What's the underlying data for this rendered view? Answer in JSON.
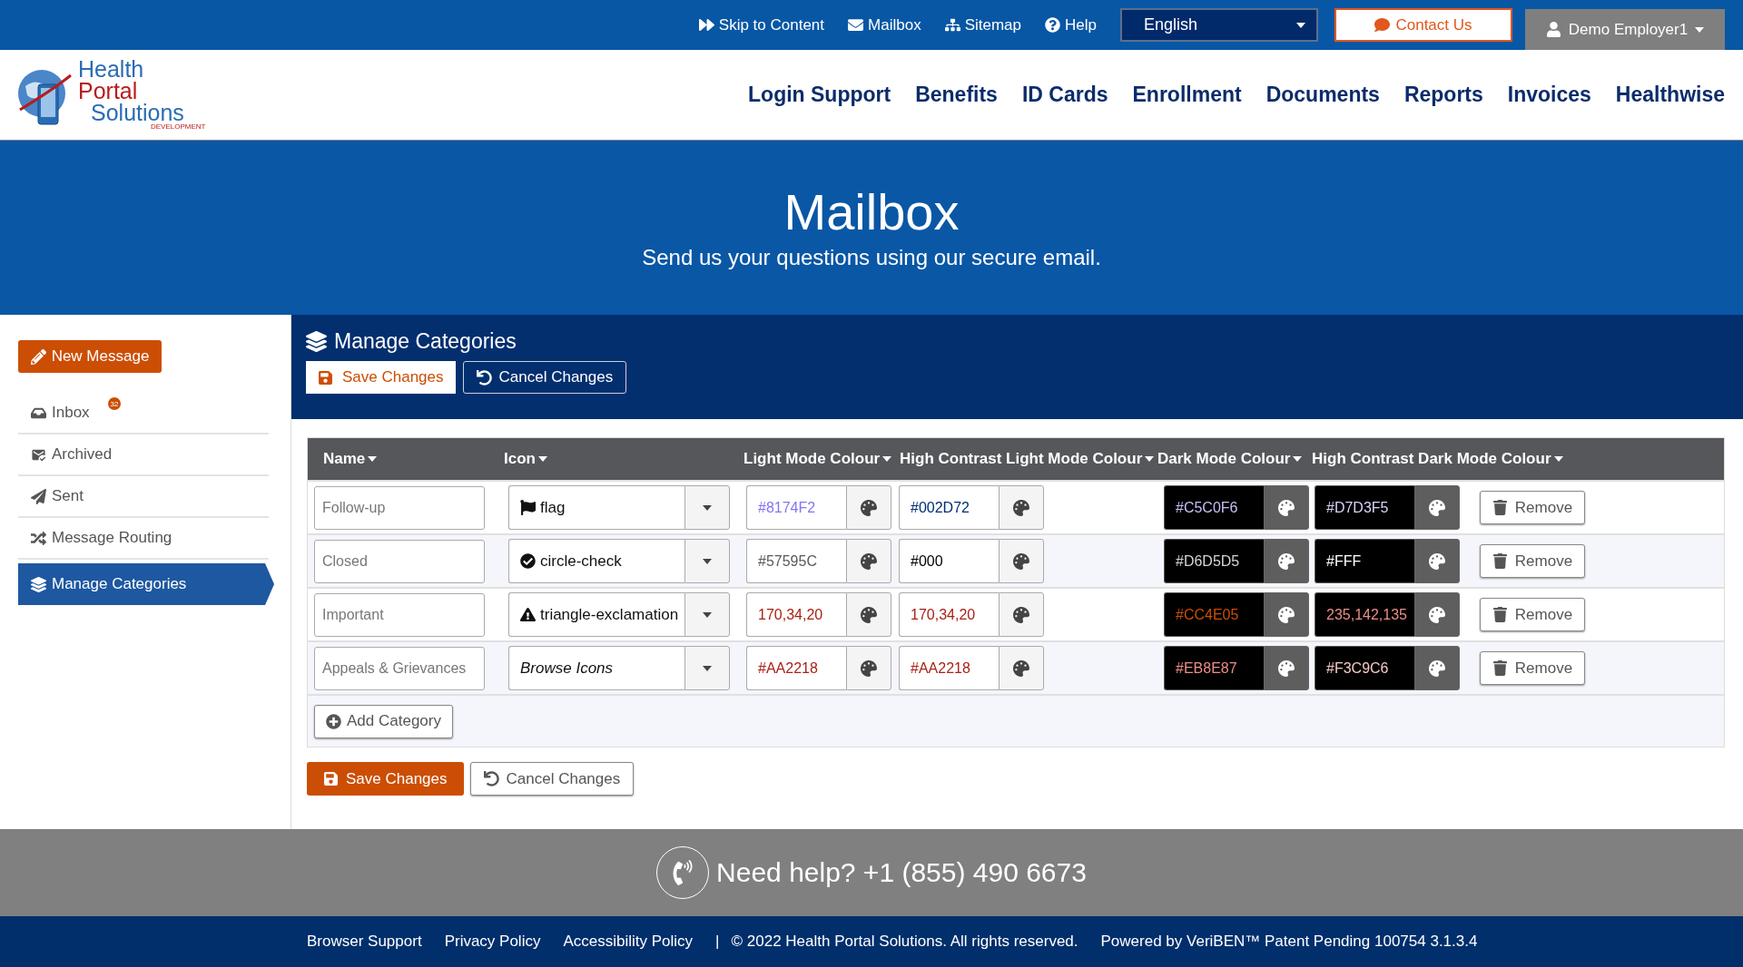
{
  "top_bar": {
    "links": [
      {
        "kind": "skip",
        "label": "Skip to Content"
      },
      {
        "kind": "mail",
        "label": "Mailbox"
      },
      {
        "kind": "sitemap",
        "label": "Sitemap"
      },
      {
        "kind": "help",
        "label": "Help"
      }
    ],
    "language": "English",
    "contact": "Contact Us",
    "user": "Demo Employer1"
  },
  "logo": {
    "line1": "Health",
    "line2": "Portal",
    "line3": "Solutions",
    "tag": "DEVELOPMENT"
  },
  "nav": [
    "Login Support",
    "Benefits",
    "ID Cards",
    "Enrollment",
    "Documents",
    "Reports",
    "Invoices",
    "Healthwise"
  ],
  "hero": {
    "title": "Mailbox",
    "subtitle": "Send us your questions using our secure email."
  },
  "sidebar": {
    "new_message": "New Message",
    "items": [
      {
        "kind": "inbox",
        "label": "Inbox",
        "badge": "32",
        "selected": false
      },
      {
        "kind": "archived",
        "label": "Archived",
        "selected": false
      },
      {
        "kind": "sent",
        "label": "Sent",
        "selected": false
      },
      {
        "kind": "routing",
        "label": "Message Routing",
        "selected": false
      },
      {
        "kind": "categories",
        "label": "Manage Categories",
        "selected": true
      }
    ]
  },
  "panel": {
    "title": "Manage Categories",
    "save": "Save Changes",
    "cancel": "Cancel Changes"
  },
  "table": {
    "columns": [
      "Name",
      "Icon",
      "Light Mode Colour",
      "High Contrast Light Mode Colour",
      "Dark Mode Colour",
      "High Contrast Dark Mode Colour"
    ],
    "rows": [
      {
        "name": "Follow-up",
        "icon": {
          "kind": "flag",
          "label": "flag"
        },
        "colours": [
          {
            "value": "#8174F2",
            "color": "#8174f2"
          },
          {
            "value": "#002D72",
            "color": "#002d72"
          },
          {
            "value": "#C5C0F6",
            "color": "#c5c0f6"
          },
          {
            "value": "#D7D3F5",
            "color": "#d7d3f5"
          }
        ],
        "remove": "Remove"
      },
      {
        "name": "Closed",
        "icon": {
          "kind": "circle-check",
          "label": "circle-check"
        },
        "colours": [
          {
            "value": "#57595C",
            "color": "#57595c"
          },
          {
            "value": "#000",
            "color": "#000000"
          },
          {
            "value": "#D6D5D5",
            "color": "#d6d5d5"
          },
          {
            "value": "#FFF",
            "color": "#ffffff"
          }
        ],
        "remove": "Remove"
      },
      {
        "name": "Important",
        "icon": {
          "kind": "triangle-exclamation",
          "label": "triangle-exclamation"
        },
        "colours": [
          {
            "value": "170,34,20",
            "color": "#aa2214"
          },
          {
            "value": "170,34,20",
            "color": "#aa2214"
          },
          {
            "value": "#CC4E05",
            "color": "#cc4e05"
          },
          {
            "value": "235,142,135",
            "color": "#eb8e87"
          }
        ],
        "remove": "Remove"
      },
      {
        "name": "Appeals & Grievances",
        "icon": {
          "kind": "none",
          "placeholder": "Browse Icons"
        },
        "colours": [
          {
            "value": "#AA2218",
            "color": "#aa2218"
          },
          {
            "value": "#AA2218",
            "color": "#aa2218"
          },
          {
            "value": "#EB8E87",
            "color": "#eb8e87"
          },
          {
            "value": "#F3C9C6",
            "color": "#f3c9c6"
          }
        ],
        "remove": "Remove"
      }
    ],
    "add": "Add Category"
  },
  "actions": {
    "save": "Save Changes",
    "cancel": "Cancel Changes"
  },
  "help": "Need help? +1 (855) 490 6673",
  "footer": {
    "links": [
      "Browser Support",
      "Privacy Policy",
      "Accessibility Policy"
    ],
    "separator": "|",
    "copyright": "© 2022 Health Portal Solutions. All rights reserved.",
    "powered": "Powered by VeriBEN™ Patent Pending 100754 3.1.3.4"
  }
}
